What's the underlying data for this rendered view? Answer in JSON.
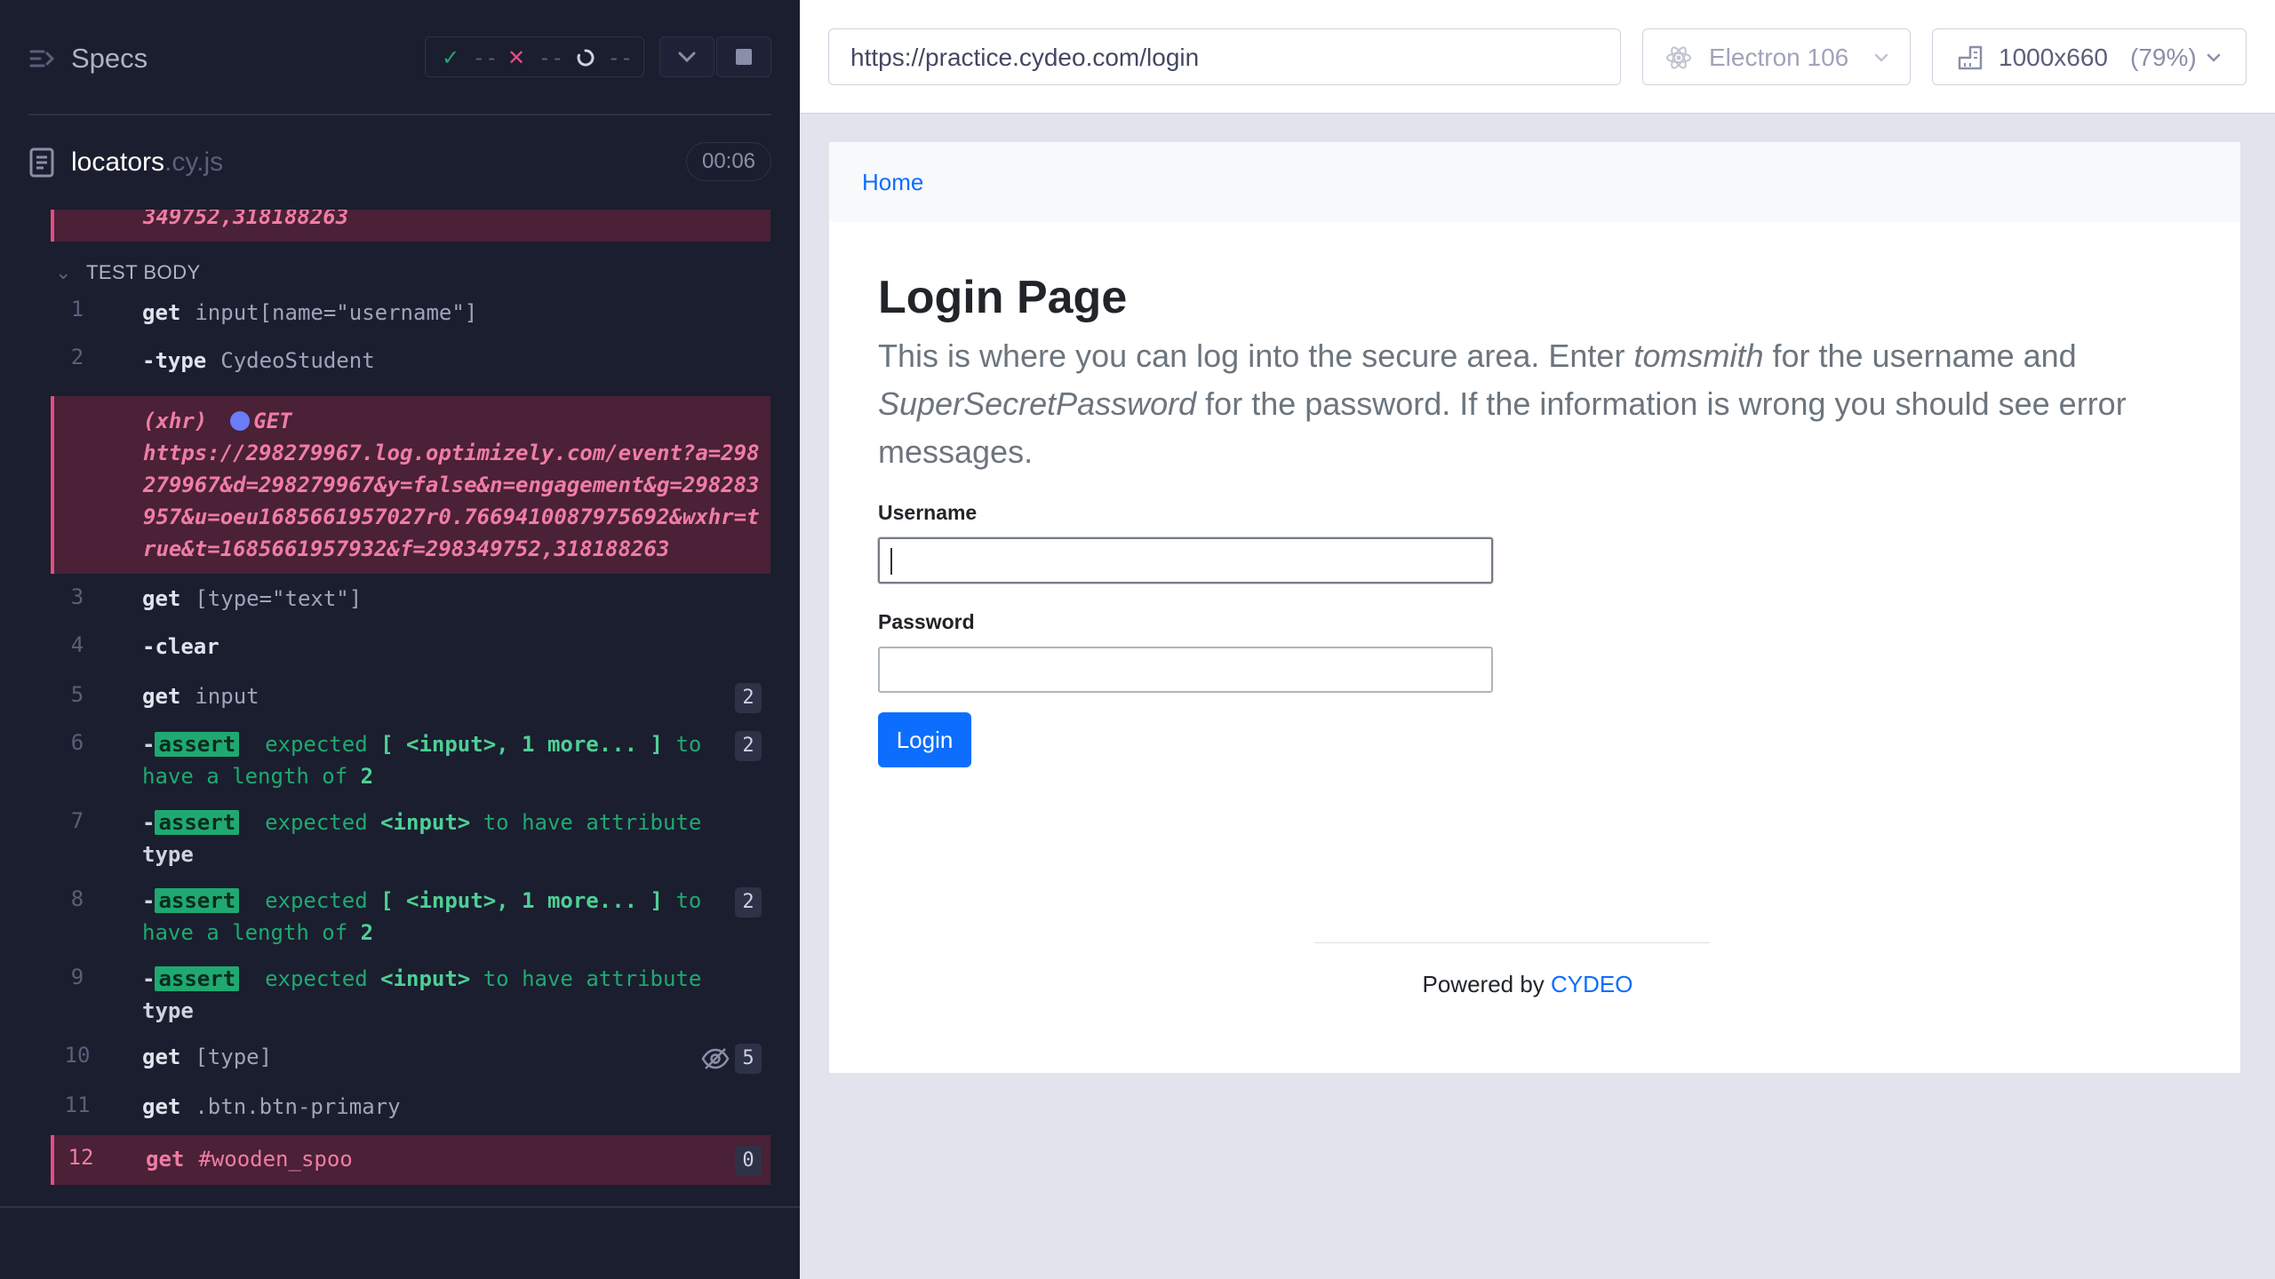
{
  "specs": {
    "title": "Specs",
    "stats": {
      "passed": "--",
      "failed": "--",
      "pending": "--"
    }
  },
  "file": {
    "name": "locators",
    "ext": ".cy.js",
    "duration": "00:06"
  },
  "log": {
    "prev_error_tail": "349752,318188263",
    "test_body_label": "TEST BODY",
    "commands": [
      {
        "num": "1",
        "name": "get",
        "msg": "input[name=\"username\"]"
      },
      {
        "num": "2",
        "name": "-type",
        "msg": "CydeoStudent"
      },
      {
        "num": "3",
        "name": "get",
        "msg": "[type=\"text\"]"
      },
      {
        "num": "4",
        "name": "-clear",
        "msg": ""
      },
      {
        "num": "5",
        "name": "get",
        "msg": "input",
        "badge": "2"
      },
      {
        "num": "6",
        "tag": "assert",
        "line1": "expected",
        "line1b": "[ <input>, 1 more... ]",
        "line1c": "to",
        "line2": "have a length of",
        "line2b": "2",
        "badge": "2"
      },
      {
        "num": "7",
        "tag": "assert",
        "line1": "expected",
        "line1b": "<input>",
        "line1c": "to have attribute",
        "line2": "",
        "line2b": "type"
      },
      {
        "num": "8",
        "tag": "assert",
        "line1": "expected",
        "line1b": "[ <input>, 1 more... ]",
        "line1c": "to",
        "line2": "have a length of",
        "line2b": "2",
        "badge": "2"
      },
      {
        "num": "9",
        "tag": "assert",
        "line1": "expected",
        "line1b": "<input>",
        "line1c": "to have attribute",
        "line2": "",
        "line2b": "type"
      },
      {
        "num": "10",
        "name": "get",
        "msg": "[type]",
        "badge": "5"
      },
      {
        "num": "11",
        "name": "get",
        "msg": ".btn.btn-primary"
      },
      {
        "num": "12",
        "name": "get",
        "msg": "#wooden_spoo",
        "badge": "0"
      }
    ],
    "xhr": {
      "label": "(xhr)",
      "method": "GET",
      "url": "https://298279967.log.optimizely.com/event?a=298279967&d=298279967&y=false&n=engagement&g=298283957&u=oeu1685661957027r0.7669410087975692&wxhr=true&t=1685661957932&f=298349752,318188263"
    }
  },
  "topbar": {
    "url": "https://practice.cydeo.com/login",
    "browser": "Electron 106",
    "viewport": "1000x660",
    "scale": "(79%)"
  },
  "aut": {
    "nav_home": "Home",
    "title": "Login Page",
    "lead_1": "This is where you can log into the secure area. Enter ",
    "lead_user": "tomsmith",
    "lead_2": " for the username and ",
    "lead_pass": "SuperSecretPassword",
    "lead_3": " for the password. If the information is wrong you should see error messages.",
    "username_label": "Username",
    "password_label": "Password",
    "login_button": "Login",
    "footer_text": "Powered by ",
    "footer_link": "CYDEO"
  },
  "colors": {
    "panel_bg": "#1b1e2e",
    "failed_bg": "#4a2137",
    "failed_accent": "#e24e83",
    "assert_green": "#1fa971",
    "primary_blue": "#0d6efd"
  }
}
